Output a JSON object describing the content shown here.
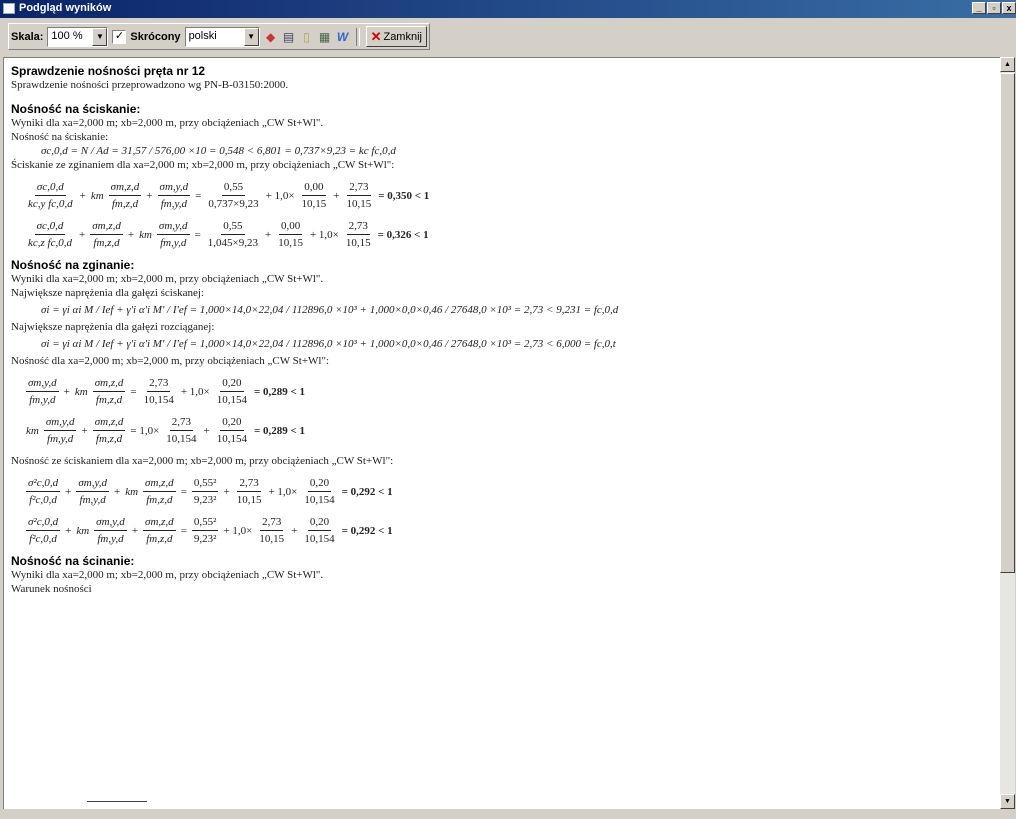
{
  "window": {
    "title": "Podgląd wyników",
    "min": "_",
    "max": "▫",
    "close": "x"
  },
  "toolbar": {
    "scale_label": "Skala:",
    "scale_value": "100 %",
    "shortened_label": "Skrócony",
    "shortened_checked": "✓",
    "language_value": "polski",
    "close_label": "Zamknij"
  },
  "doc": {
    "title": "Sprawdzenie nośności pręta nr 12",
    "standard": "Sprawdzenie nośności przeprowadzono wg PN-B-03150:2000.",
    "comp_head": "Nośność na ściskanie",
    "comp_results": "Wyniki dla xa=2,000 m; xb=2,000 m, przy obciążeniach „CW St+Wl\".",
    "comp_line": "Nośność na ściskanie:",
    "comp_eq": "σc,0,d = N / Ad = 31,57 / 576,00 ×10 = 0,548 < 6,801 = 0,737×9,23 = kc fc,0,d",
    "combined_line": "Ściskanie ze zginaniem dla xa=2,000 m; xb=2,000 m, przy obciążeniach „CW St+Wl\":",
    "f1": {
      "a_n": "σc,0,d",
      "a_d": "kc,y fc,0,d",
      "km": "km",
      "b_n": "σm,z,d",
      "b_d": "fm,z,d",
      "c_n": "σm,y,d",
      "c_d": "fm,y,d",
      "v1_n": "0,55",
      "v1_d": "0,737×9,23",
      "coef": "+ 1,0×",
      "v2_n": "0,00",
      "v2_d": "10,15",
      "v3_n": "2,73",
      "v3_d": "10,15",
      "result": "= 0,350 < 1"
    },
    "f2": {
      "a_n": "σc,0,d",
      "a_d": "kc,z fc,0,d",
      "b_n": "σm,z,d",
      "b_d": "fm,z,d",
      "km": "km",
      "c_n": "σm,y,d",
      "c_d": "fm,y,d",
      "v1_n": "0,55",
      "v1_d": "1,045×9,23",
      "v2_n": "0,00",
      "v2_d": "10,15",
      "coef": "+ 1,0×",
      "v3_n": "2,73",
      "v3_d": "10,15",
      "result": "= 0,326 < 1"
    },
    "bend_head": "Nośność na zginanie",
    "bend_results": "Wyniki dla xa=2,000 m; xb=2,000 m, przy obciążeniach „CW St+Wl\".",
    "comp_branch": "Największe naprężenia dla gałęzi ściskanej:",
    "eq_comp": "σi = γi αi M / Ief + γ'i α'i M' / I'ef = 1,000×14,0×22,04 / 112896,0 ×10³ + 1,000×0,0×0,46 / 27648,0 ×10³ = 2,73 < 9,231 = fc,0,d",
    "tens_branch": "Największe naprężenia dla gałęzi rozciąganej:",
    "eq_tens": "σi = γi αi M / Ief + γ'i α'i M' / I'ef = 1,000×14,0×22,04 / 112896,0 ×10³ + 1,000×0,0×0,46 / 27648,0 ×10³ = 2,73 < 6,000 = fc,0,t",
    "bend_capacity": "Nośność dla xa=2,000 m; xb=2,000 m, przy obciążeniach „CW St+Wl\":",
    "f3": {
      "a_n": "σm,y,d",
      "a_d": "fm,y,d",
      "km": "km",
      "b_n": "σm,z,d",
      "b_d": "fm,z,d",
      "v1_n": "2,73",
      "v1_d": "10,154",
      "coef": "+ 1,0×",
      "v2_n": "0,20",
      "v2_d": "10,154",
      "result": "= 0,289 < 1"
    },
    "f4": {
      "km": "km",
      "a_n": "σm,y,d",
      "a_d": "fm,y,d",
      "b_n": "σm,z,d",
      "b_d": "fm,z,d",
      "coef": "= 1,0×",
      "v1_n": "2,73",
      "v1_d": "10,154",
      "v2_n": "0,20",
      "v2_d": "10,154",
      "result": "= 0,289 < 1"
    },
    "combined2_line": "Nośność ze ściskaniem dla xa=2,000 m; xb=2,000 m, przy obciążeniach „CW St+Wl\":",
    "f5": {
      "a_n": "σ²c,0,d",
      "a_d": "f²c,0,d",
      "b_n": "σm,y,d",
      "b_d": "fm,y,d",
      "km": "km",
      "c_n": "σm,z,d",
      "c_d": "fm,z,d",
      "v1_n": "0,55²",
      "v1_d": "9,23²",
      "v2_n": "2,73",
      "v2_d": "10,15",
      "coef": "+ 1,0×",
      "v3_n": "0,20",
      "v3_d": "10,154",
      "result": "= 0,292 < 1"
    },
    "f6": {
      "a_n": "σ²c,0,d",
      "a_d": "f²c,0,d",
      "km": "km",
      "b_n": "σm,y,d",
      "b_d": "fm,y,d",
      "c_n": "σm,z,d",
      "c_d": "fm,z,d",
      "v1_n": "0,55²",
      "v1_d": "9,23²",
      "coef": "+ 1,0×",
      "v2_n": "2,73",
      "v2_d": "10,15",
      "v3_n": "0,20",
      "v3_d": "10,154",
      "result": "= 0,292 < 1"
    },
    "shear_head": "Nośność na ścinanie",
    "shear_results": "Wyniki dla xa=2,000 m; xb=2,000 m, przy obciążeniach „CW St+Wl\".",
    "shear_cond": "Warunek nośności"
  }
}
